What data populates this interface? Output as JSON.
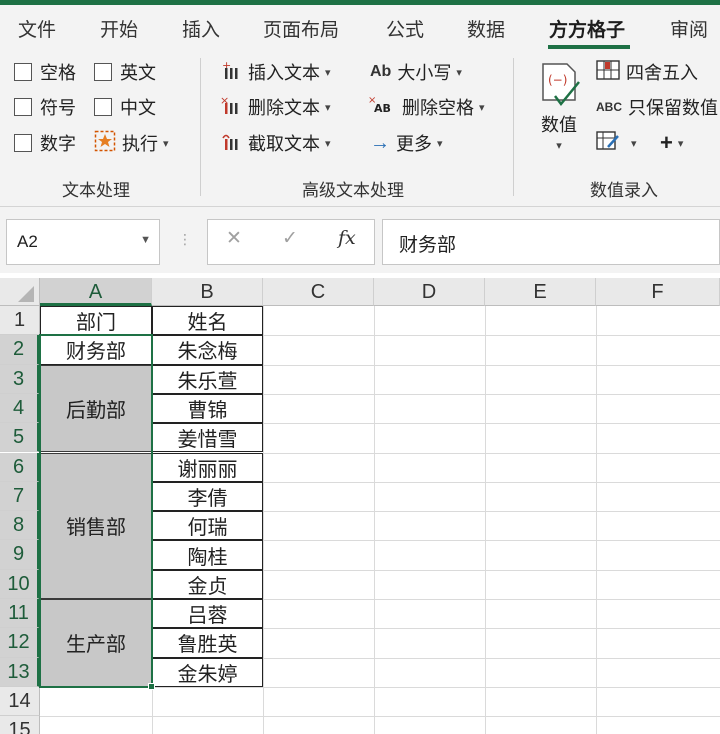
{
  "ribbon": {
    "tabs": [
      "文件",
      "开始",
      "插入",
      "页面布局",
      "公式",
      "数据",
      "方方格子",
      "审阅"
    ],
    "active_tab": "方方格子",
    "text_group": {
      "label": "文本处理",
      "checkboxes": [
        "空格",
        "英文",
        "符号",
        "中文",
        "数字"
      ],
      "execute": "执行"
    },
    "advanced_group": {
      "label": "高级文本处理",
      "insert_text": "插入文本",
      "delete_text": "删除文本",
      "extract_text": "截取文本",
      "case": "大小写",
      "case_icon_text": "Ab",
      "delete_spaces": "删除空格",
      "more": "更多"
    },
    "number_group": {
      "label": "数值录入",
      "numeric": "数值",
      "round": "四舍五入",
      "keep_numbers": "只保留数值",
      "abc_icon_text": "ABC"
    }
  },
  "formula_bar": {
    "name_box": "A2",
    "formula": "财务部",
    "fx": "fx"
  },
  "sheet": {
    "columns": [
      "A",
      "B",
      "C",
      "D",
      "E",
      "F"
    ],
    "rows": [
      "1",
      "2",
      "3",
      "4",
      "5",
      "6",
      "7",
      "8",
      "9",
      "10",
      "11",
      "12",
      "13",
      "14",
      "15"
    ],
    "header_a": "部门",
    "header_b": "姓名",
    "departments": [
      "财务部",
      "后勤部",
      "销售部",
      "生产部"
    ],
    "names": [
      "朱念梅",
      "朱乐萱",
      "曹锦",
      "姜惜雪",
      "谢丽丽",
      "李倩",
      "何瑞",
      "陶桂",
      "金贞",
      "吕蓉",
      "鲁胜英",
      "金朱婷"
    ]
  },
  "colors": {
    "accent": "#1e7145",
    "merged_fill": "#c8c8c8"
  }
}
